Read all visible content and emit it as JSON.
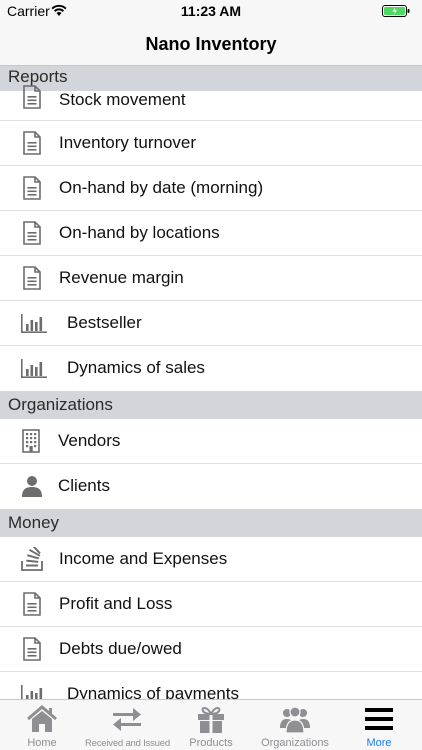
{
  "status_bar": {
    "carrier": "Carrier",
    "time": "11:23 AM",
    "battery_color": "#4cd964"
  },
  "nav": {
    "title": "Nano Inventory"
  },
  "sections": {
    "reports": {
      "header": "Reports",
      "items": [
        {
          "label": "Stock movement",
          "icon": "document-icon"
        },
        {
          "label": "Inventory turnover",
          "icon": "document-icon"
        },
        {
          "label": "On-hand by date (morning)",
          "icon": "document-icon"
        },
        {
          "label": "On-hand by locations",
          "icon": "document-icon"
        },
        {
          "label": "Revenue margin",
          "icon": "document-icon"
        },
        {
          "label": "Bestseller",
          "icon": "bar-chart-icon"
        },
        {
          "label": "Dynamics of sales",
          "icon": "bar-chart-icon"
        }
      ]
    },
    "organizations": {
      "header": "Organizations",
      "items": [
        {
          "label": "Vendors",
          "icon": "building-icon"
        },
        {
          "label": "Clients",
          "icon": "person-icon"
        }
      ]
    },
    "money": {
      "header": "Money",
      "items": [
        {
          "label": "Income and Expenses",
          "icon": "stack-icon"
        },
        {
          "label": "Profit and Loss",
          "icon": "document-icon"
        },
        {
          "label": "Debts due/owed",
          "icon": "document-icon"
        },
        {
          "label": "Dynamics of payments",
          "icon": "bar-chart-icon"
        }
      ]
    }
  },
  "tabs": [
    {
      "label": "Home",
      "icon": "home-icon"
    },
    {
      "label": "Received and Issued",
      "icon": "transfer-arrows-icon"
    },
    {
      "label": "Products",
      "icon": "gift-icon"
    },
    {
      "label": "Organizations",
      "icon": "people-icon"
    },
    {
      "label": "More",
      "icon": "menu-icon",
      "active": true
    }
  ],
  "colors": {
    "accent": "#1e7df0",
    "section_header_bg": "#d2d5d9",
    "icon_gray": "#6d6d6d",
    "tab_inactive": "#8e8e93"
  }
}
